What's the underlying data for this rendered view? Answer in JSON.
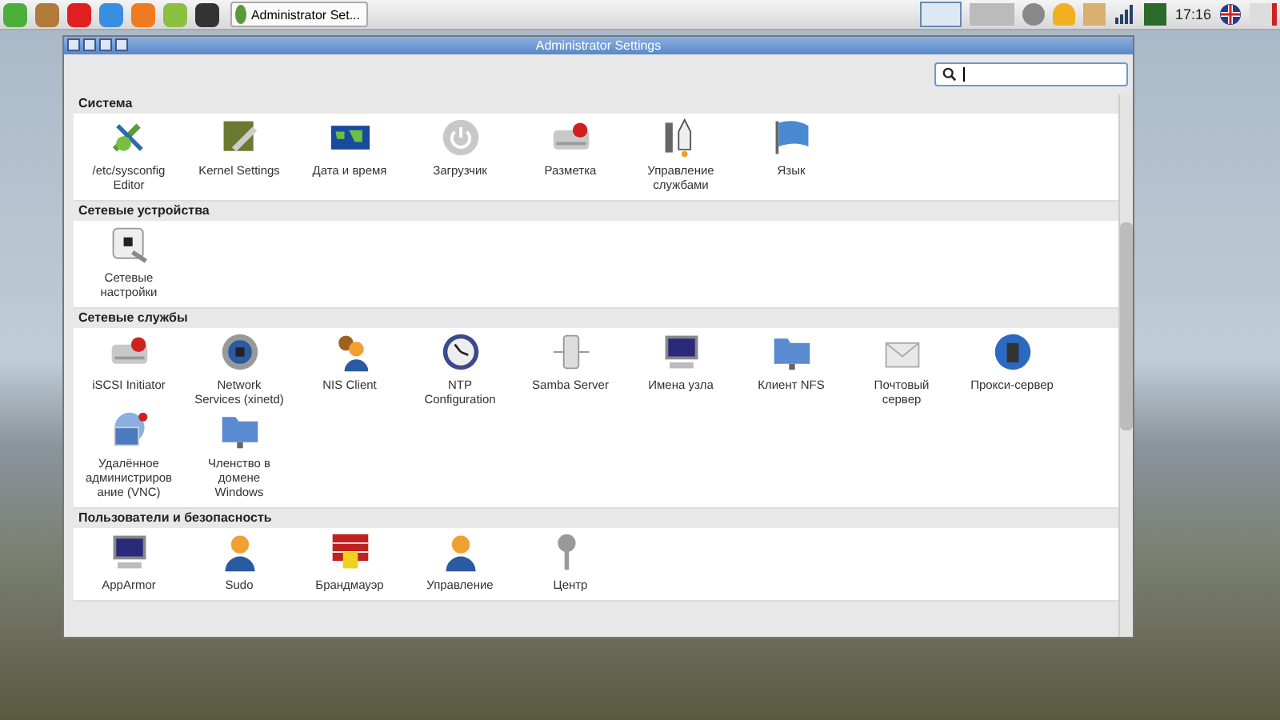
{
  "taskbar": {
    "task_button": "Administrator Set...",
    "clock": "17:16"
  },
  "window": {
    "title": "Administrator Settings"
  },
  "sections": [
    {
      "title": "Система",
      "items": [
        "/etc/sysconfig Editor",
        "Kernel Settings",
        "Дата и время",
        "Загрузчик",
        "Разметка",
        "Управление службами",
        "Язык"
      ]
    },
    {
      "title": "Сетевые устройства",
      "items": [
        "Сетевые настройки"
      ]
    },
    {
      "title": "Сетевые службы",
      "items": [
        "iSCSI Initiator",
        "Network Services (xinetd)",
        "NIS Client",
        "NTP Configuration",
        "Samba Server",
        "Имена узла",
        "Клиент NFS",
        "Почтовый сервер",
        "Прокси-сервер",
        "Удалённое администрирование (VNC)",
        "Членство в домене Windows"
      ]
    },
    {
      "title": "Пользователи и безопасность",
      "items": [
        "AppArmor",
        "Sudo",
        "Брандмауэр",
        "Управление",
        "Центр"
      ]
    }
  ]
}
